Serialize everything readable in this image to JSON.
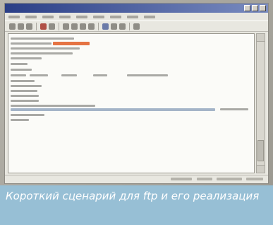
{
  "window": {
    "title": "",
    "menu": [
      "",
      "",
      "",
      "",
      "",
      "",
      "",
      "",
      ""
    ]
  },
  "caption": "Короткий сценарий для ftp и его реализация",
  "colors": {
    "caption_bg": "#97bfd5",
    "highlight": "#e2642f",
    "titlebar": "#2a3e86"
  }
}
